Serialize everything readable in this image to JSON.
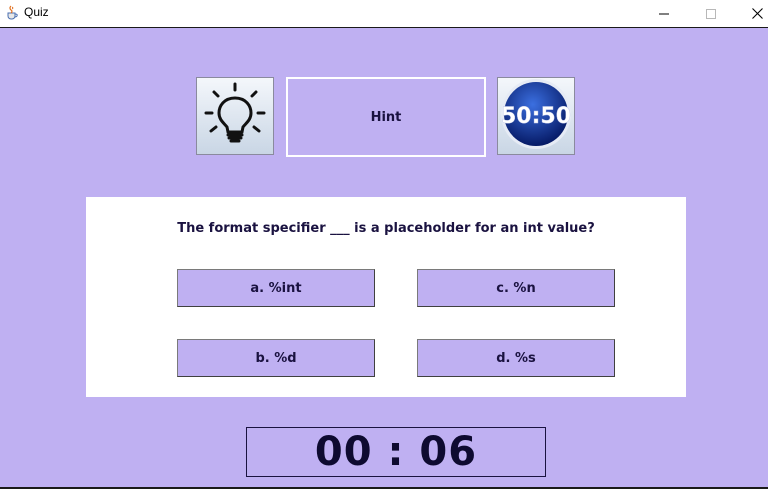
{
  "window": {
    "title": "Quiz",
    "icons": {
      "app": "java-cup-icon",
      "minimize": "minimize-icon",
      "maximize": "maximize-icon",
      "close": "close-icon"
    }
  },
  "lifelines": {
    "hint_icon": "lightbulb-icon",
    "hint_label": "Hint",
    "fifty_label": "50:50"
  },
  "quiz": {
    "question": "The format specifier ___ is a placeholder for an int value?",
    "options": [
      {
        "label": "a. %int"
      },
      {
        "label": "c. %n"
      },
      {
        "label": "b. %d"
      },
      {
        "label": "d. %s"
      }
    ]
  },
  "timer": {
    "display": "00 : 06"
  },
  "colors": {
    "background": "#bfb0f2",
    "option_fill": "#bfb0f2",
    "text": "#1a1240",
    "badge_blue": "#0b2a8f"
  }
}
